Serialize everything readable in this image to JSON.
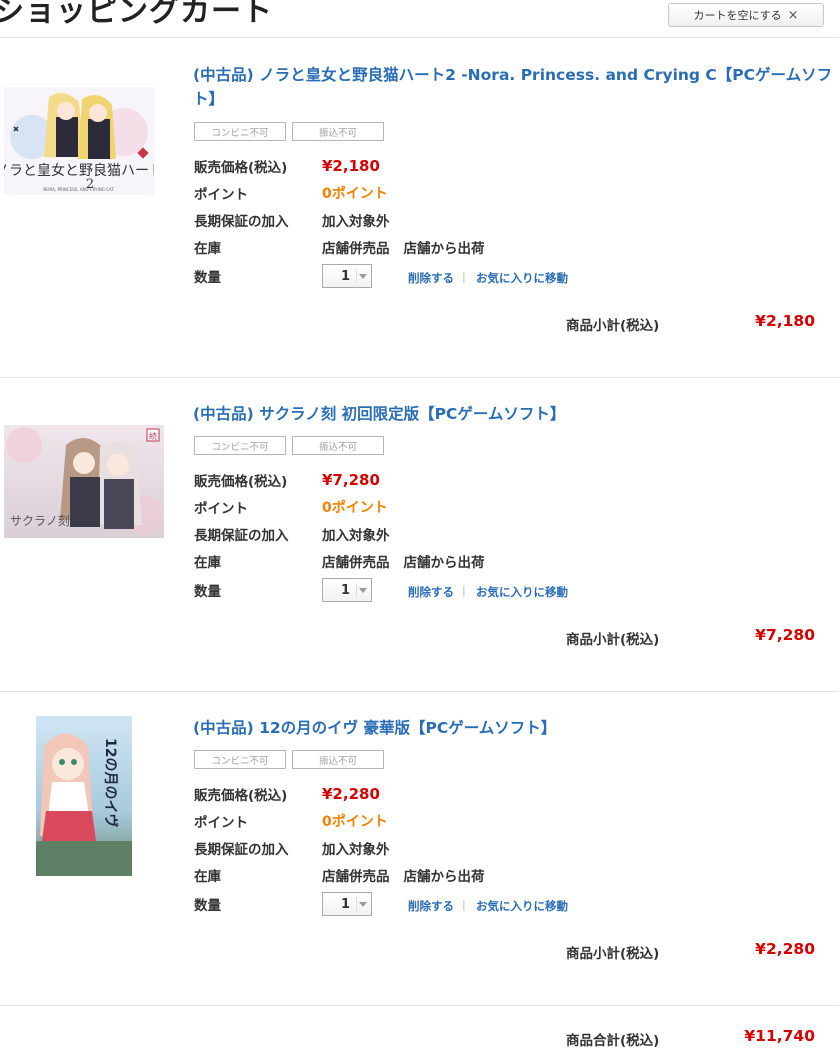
{
  "header": {
    "title": "ショッピングカート",
    "empty_cart_label": "カートを空にする",
    "empty_cart_icon": "×"
  },
  "labels": {
    "price": "販売価格(税込)",
    "point": "ポイント",
    "warranty": "長期保証の加入",
    "stock": "在庫",
    "quantity": "数量",
    "delete": "削除する",
    "favorite": "お気に入りに移動",
    "subtotal": "商品小計(税込)",
    "badge_convenience": "コンビニ不可",
    "badge_transfer": "振込不可"
  },
  "items": [
    {
      "title": "(中古品) ノラと皇女と野良猫ハート2 -Nora. Princess. and Crying C【PCゲームソフト】",
      "price": "¥2,180",
      "point": "0ポイント",
      "warranty": "加入対象外",
      "stock": "店舗併売品",
      "shipping": "店舗から出荷",
      "quantity": "1",
      "subtotal": "¥2,180",
      "cover_text": "ノラと皇女と野良猫ハート",
      "cover_num": "2",
      "cover_sub": "NORA, PRINCESS, AND CRYING CAT."
    },
    {
      "title": "(中古品) サクラノ刻 初回限定版【PCゲームソフト】",
      "price": "¥7,280",
      "point": "0ポイント",
      "warranty": "加入対象外",
      "stock": "店舗併売品",
      "shipping": "店舗から出荷",
      "quantity": "1",
      "subtotal": "¥7,280",
      "cover_text": "サクラノ刻",
      "cover_stamp": "続"
    },
    {
      "title": "(中古品) 12の月のイヴ 豪華版【PCゲームソフト】",
      "price": "¥2,280",
      "point": "0ポイント",
      "warranty": "加入対象外",
      "stock": "店舗併売品",
      "shipping": "店舗から出荷",
      "quantity": "1",
      "subtotal": "¥2,280",
      "cover_text": "12の月のイヴ"
    }
  ],
  "total": {
    "label": "商品合計(税込)",
    "value": "¥11,740"
  },
  "colors": {
    "link": "#2a6db5",
    "price": "#d40000",
    "point": "#f08200"
  }
}
